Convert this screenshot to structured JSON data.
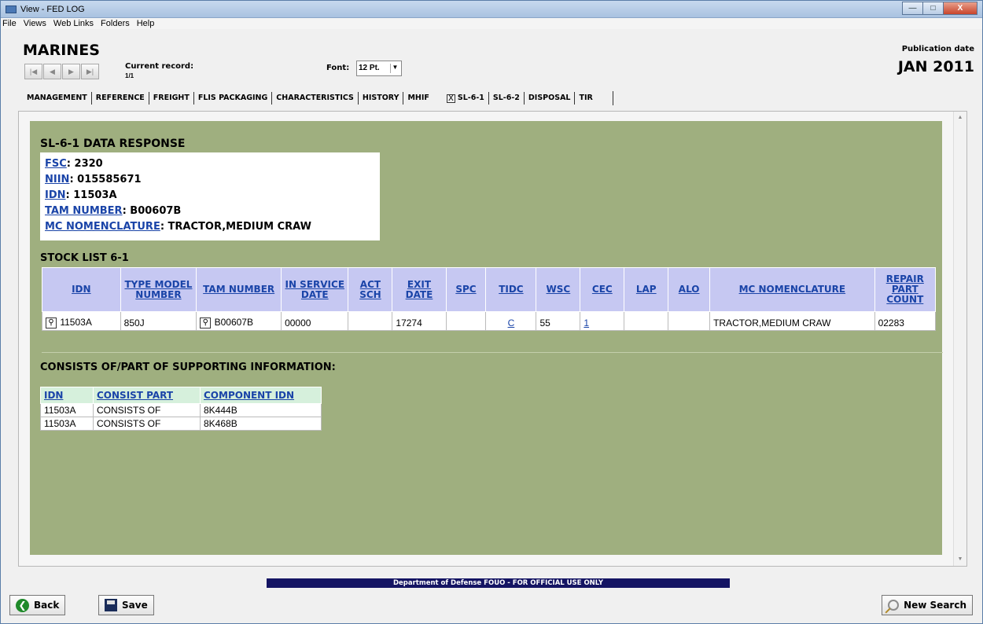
{
  "window": {
    "title": "View - FED LOG",
    "min_label": "—",
    "max_label": "□",
    "close_label": "X"
  },
  "menu": [
    "File",
    "Views",
    "Web Links",
    "Folders",
    "Help"
  ],
  "header": {
    "org": "MARINES",
    "current_record_label": "Current record:",
    "current_record_value": "1/1",
    "font_label": "Font:",
    "font_value": "12 Pt.",
    "publication_label": "Publication date",
    "publication_value": "JAN 2011",
    "nav": {
      "first": "|◀",
      "prev": "◀",
      "next": "▶",
      "last": "▶|"
    }
  },
  "tabs": [
    "MANAGEMENT",
    "REFERENCE",
    "FREIGHT",
    "FLIS PACKAGING",
    "CHARACTERISTICS",
    "HISTORY",
    "MHIF",
    "SL-6-1",
    "SL-6-2",
    "DISPOSAL",
    "TIR"
  ],
  "active_tab_marker": "X",
  "sl61": {
    "title": "SL-6-1 DATA RESPONSE",
    "fsc_label": "FSC",
    "fsc": ": 2320",
    "niin_label": "NIIN",
    "niin": ": 015585671",
    "idn_label": "IDN",
    "idn": ": 11503A",
    "tam_label": "TAM NUMBER",
    "tam": ": B00607B",
    "mcnom_label": "MC NOMENCLATURE",
    "mcnom": ":  TRACTOR,MEDIUM CRAW"
  },
  "stock_list": {
    "title": "STOCK LIST 6-1",
    "headers": {
      "idn": "IDN",
      "type_model": "TYPE MODEL NUMBER",
      "tam": "TAM NUMBER",
      "in_service": "IN SERVICE DATE",
      "act_sch": "ACT SCH",
      "exit_date": "EXIT DATE",
      "spc": "SPC",
      "tidc": "TIDC",
      "wsc": "WSC",
      "cec": "CEC",
      "lap": "LAP",
      "alo": "ALO",
      "mc_nom": "MC NOMENCLATURE",
      "repair": "REPAIR PART COUNT"
    },
    "row": {
      "idn": "11503A",
      "type_model": "850J",
      "tam": "B00607B",
      "in_service": "00000",
      "act_sch": "",
      "exit_date": "17274",
      "spc": "",
      "tidc": "C",
      "wsc": "55",
      "cec": "1",
      "lap": "",
      "alo": "",
      "mc_nom": "TRACTOR,MEDIUM CRAW",
      "repair": "02283"
    },
    "magnifier_glyph": "⚲"
  },
  "consists": {
    "title": "CONSISTS OF/PART OF SUPPORTING INFORMATION:",
    "headers": {
      "idn": "IDN",
      "consist_part": "CONSIST PART",
      "component_idn": "COMPONENT IDN"
    },
    "rows": [
      {
        "idn": "11503A",
        "consist_part": "CONSISTS OF",
        "component_idn": "8K444B"
      },
      {
        "idn": "11503A",
        "consist_part": "CONSISTS OF",
        "component_idn": "8K468B"
      }
    ]
  },
  "footer": {
    "fouo": "Department of Defense FOUO - FOR OFFICIAL USE ONLY",
    "back": "Back",
    "back_glyph": "❮",
    "save": "Save",
    "new_search": "New Search"
  },
  "scroll": {
    "up": "▲",
    "down": "▼"
  }
}
